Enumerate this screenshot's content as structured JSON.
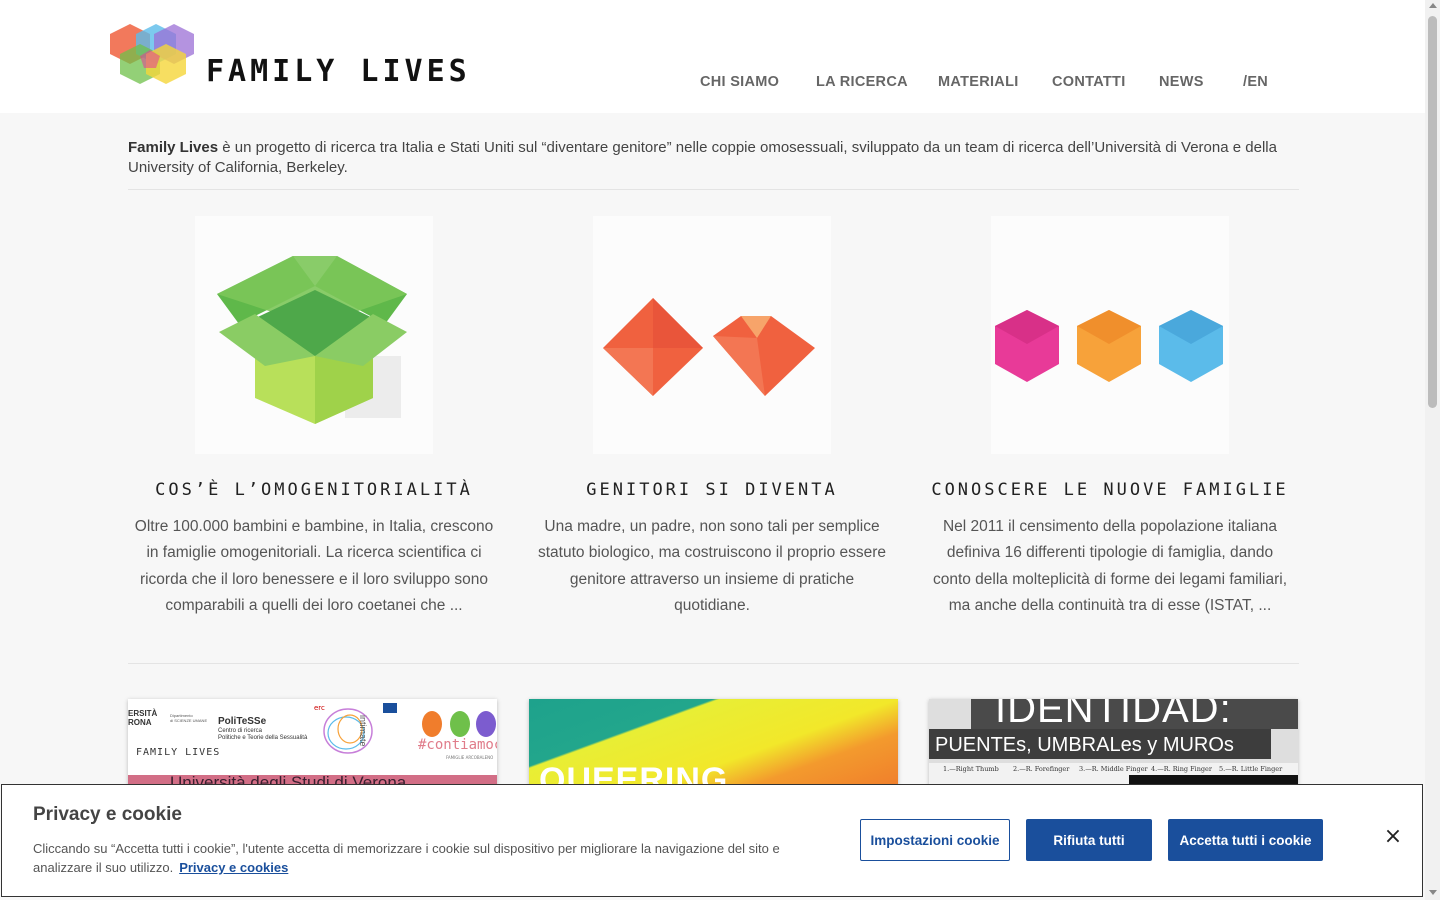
{
  "header": {
    "brand": "FAMILY LIVES",
    "nav": [
      "CHI SIAMO",
      "LA RICERCA",
      "MATERIALI",
      "CONTATTI",
      "NEWS",
      "/EN"
    ]
  },
  "intro": {
    "brand_bold": "Family Lives",
    "text": " è un progetto di ricerca tra Italia e Stati Uniti sul “diventare genitore” nelle coppie omosessuali, sviluppato da un team di ricerca dell’Università di Verona e della University of California, Berkeley."
  },
  "features": [
    {
      "title": "COS’È L’OMOGENITORIALITÀ",
      "text": "Oltre 100.000 bambini e bambine, in Italia, crescono in famiglie omogenitoriali. La ricerca scientifica ci ricorda che il loro benessere e il loro sviluppo sono comparabili a quelli dei loro coetanei che ..."
    },
    {
      "title": "GENITORI SI DIVENTA",
      "text": "Una madre, un padre, non sono tali per semplice statuto biologico, ma costruiscono il proprio essere genitore attraverso un insieme di pratiche quotidiane."
    },
    {
      "title": "CONOSCERE LE NUOVE FAMIGLIE",
      "text": "Nel 2011 il censimento della popolazione italiana definiva 16 differenti tipologie di famiglia, dando conto della molteplicità di forme dei legami familiari, ma anche della continuità tra di esse (ISTAT, ..."
    }
  ],
  "news_thumbs": {
    "t1": {
      "uni": "ERSITÀ\nRONA",
      "dept": "Dipartimento\ndi SCIENZE UMANE",
      "politesse": "PoliTeSSe",
      "politesse_sub": "Centro di ricerca\nPolitiche e Teorie della Sessualità",
      "brand": "FAMILY LIVES",
      "erc": "erc",
      "intimate": "intimate",
      "hashtag": "#contiamoci",
      "hashtag_sub": "FAMIGLIE ARCOBALENO",
      "banner": "Università degli Studi di Verona"
    },
    "t2": {
      "text": "QUEERING"
    },
    "t3": {
      "title": "IDENTIDAD:",
      "subtitle": "PUENTEs, UMBRALes y MUROs",
      "fingers": [
        "1.—Right Thumb",
        "2.—R. Forefinger",
        "3.—R. Middle Finger",
        "4.—R. Ring Finger",
        "5.—R. Little Finger"
      ]
    }
  },
  "cookie": {
    "title": "Privacy e cookie",
    "text": "Cliccando su “Accetta tutti i cookie”, l'utente accetta di memorizzare i cookie sul dispositivo per migliorare la navigazione del sito e analizzare il suo utilizzo.",
    "link": "Privacy e cookies",
    "settings": "Impostazioni cookie",
    "reject": "Rifiuta tutti",
    "accept": "Accetta tutti i cookie",
    "close": "×"
  },
  "colors": {
    "accent": "#1a4f9c",
    "green": "#6fc04a",
    "orange_red": "#f0613f",
    "magenta": "#e83a98",
    "orange": "#f7a23a",
    "blue": "#5bbbea"
  },
  "icons": [
    "logo-hexagons-icon",
    "green-box-icon",
    "red-diamonds-icon",
    "colored-hexagons-icon",
    "close-icon"
  ]
}
